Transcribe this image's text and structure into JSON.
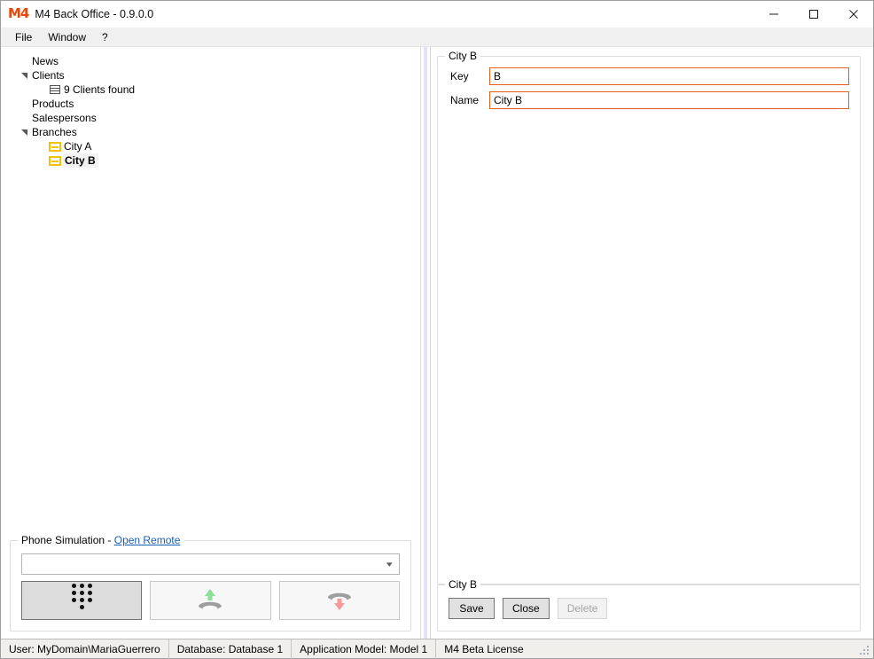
{
  "window": {
    "title": "M4 Back Office - 0.9.0.0",
    "logo_text": "M4",
    "logo_color": "#e8470a",
    "minimize_label": "Minimize",
    "maximize_label": "Maximize",
    "close_label": "Close"
  },
  "menubar": {
    "items": [
      {
        "label": "File"
      },
      {
        "label": "Window"
      },
      {
        "label": "?"
      }
    ]
  },
  "tree": {
    "items": [
      {
        "label": "News",
        "depth": 1,
        "expander": "",
        "icon": "none",
        "selected": false
      },
      {
        "label": "Clients",
        "depth": 1,
        "expander": "expanded",
        "icon": "none",
        "selected": false
      },
      {
        "label": "9 Clients found",
        "depth": 2,
        "expander": "",
        "icon": "grid",
        "selected": false
      },
      {
        "label": "Products",
        "depth": 1,
        "expander": "",
        "icon": "none",
        "selected": false
      },
      {
        "label": "Salespersons",
        "depth": 1,
        "expander": "",
        "icon": "none",
        "selected": false
      },
      {
        "label": "Branches",
        "depth": 1,
        "expander": "expanded",
        "icon": "none",
        "selected": false
      },
      {
        "label": "City A",
        "depth": 2,
        "expander": "",
        "icon": "branch",
        "selected": false
      },
      {
        "label": "City B",
        "depth": 2,
        "expander": "",
        "icon": "branch",
        "selected": true
      }
    ]
  },
  "phone_panel": {
    "title": "Phone Simulation - ",
    "link_label": "Open Remote",
    "combo_value": "",
    "combo_icon": "chevron-down-icon",
    "buttons": [
      {
        "name": "keypad-button",
        "icon": "keypad-icon",
        "state": "active"
      },
      {
        "name": "answer-call-button",
        "icon": "phone-answer-icon",
        "state": "normal"
      },
      {
        "name": "hangup-call-button",
        "icon": "phone-hangup-icon",
        "state": "normal"
      }
    ]
  },
  "detail_panel": {
    "group_title": "City B",
    "fields": [
      {
        "label": "Key",
        "value": "B",
        "placeholder": ""
      },
      {
        "label": "Name",
        "value": "City B",
        "placeholder": ""
      }
    ],
    "border_color": "#e8601c"
  },
  "actions_panel": {
    "group_title": "City B",
    "buttons": [
      {
        "label": "Save",
        "disabled": false
      },
      {
        "label": "Close",
        "disabled": false
      },
      {
        "label": "Delete",
        "disabled": true
      }
    ]
  },
  "statusbar": {
    "cells": [
      {
        "text": "User: MyDomain\\MariaGuerrero"
      },
      {
        "text": "Database: Database 1"
      },
      {
        "text": "Application Model: Model 1"
      },
      {
        "text": "M4 Beta License"
      }
    ],
    "grip_icon": "resize-grip-icon"
  }
}
